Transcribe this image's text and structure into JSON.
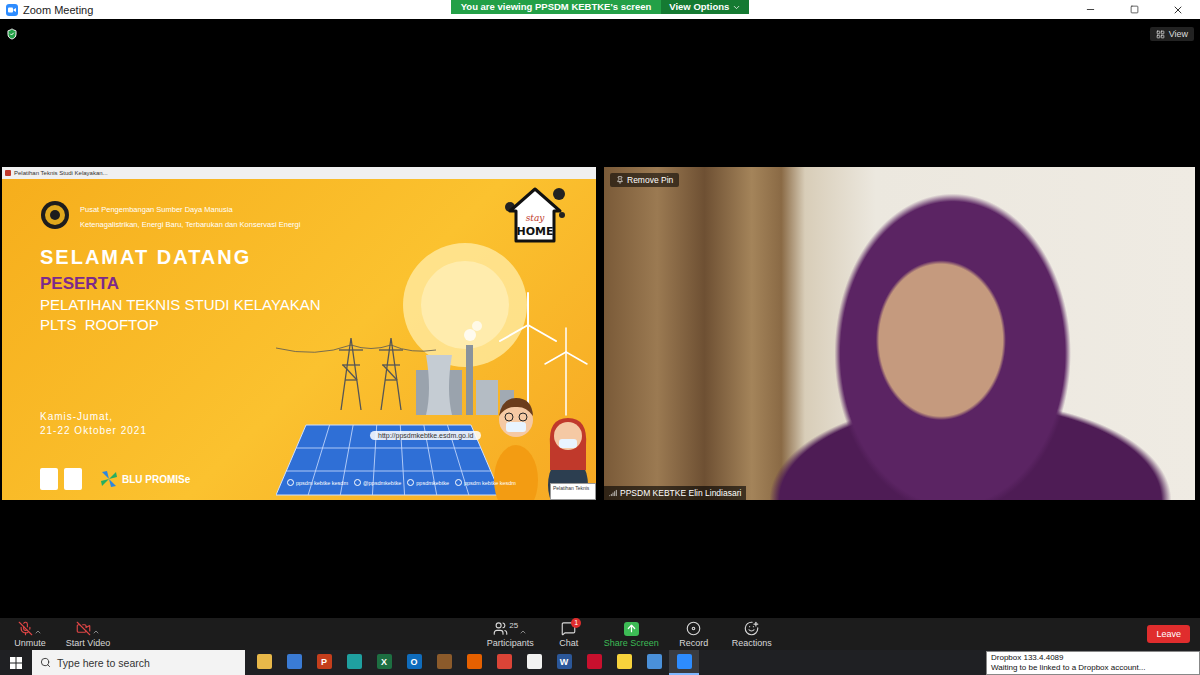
{
  "window": {
    "title": "Zoom Meeting"
  },
  "banner": {
    "text": "You are viewing PPSDM KEBTKE's screen",
    "button": "View Options"
  },
  "view_button": {
    "label": "View"
  },
  "shared_screen": {
    "window_title": "Pelatihan Teknis Studi Kelayakan...",
    "mini_window": "Pelatihan Teknis",
    "slide": {
      "org_lines": [
        "Pusat Pengembangan Sumber Daya Manusia",
        "Ketenagalistrikan, Energi Baru, Terbarukan dan Konservasi Energi"
      ],
      "badge": {
        "top": "stay",
        "bottom": "HOME"
      },
      "greeting": "SELAMAT DATANG",
      "audience": "PESERTA",
      "title_lines": [
        "PELATIHAN TEKNIS STUDI KELAYAKAN",
        "PLTS  ROOFTOP"
      ],
      "date_lines": [
        "Kamis-Jumat,",
        "21-22 Oktober 2021"
      ],
      "url": "http://ppsdmkebtke.esdm.go.id",
      "socials": [
        "ppsdm kebtke kesdm",
        "@ppsdmkebtke",
        "ppsdmkebtke",
        "ppsdm kebtke kesdm"
      ],
      "partner": "BLU PROMISe"
    }
  },
  "video": {
    "pin_button": "Remove Pin",
    "participant_name": "PPSDM KEBTKE Elin Lindiasari"
  },
  "toolbar": {
    "left": [
      {
        "label": "Unmute",
        "kind": "mic",
        "off": true,
        "caret": true
      },
      {
        "label": "Start Video",
        "kind": "video",
        "off": true,
        "caret": true
      }
    ],
    "center": [
      {
        "label": "Participants",
        "kind": "participants",
        "count": "25",
        "caret": true
      },
      {
        "label": "Chat",
        "kind": "chat",
        "badge": "1",
        "caret": false
      },
      {
        "label": "Share Screen",
        "kind": "share",
        "caret": false
      },
      {
        "label": "Record",
        "kind": "record",
        "caret": false
      },
      {
        "label": "Reactions",
        "kind": "reactions",
        "caret": false
      }
    ],
    "leave": "Leave"
  },
  "taskbar": {
    "search_placeholder": "Type here to search",
    "apps": [
      {
        "glyph": "",
        "color": "#e8b84a",
        "selected": false
      },
      {
        "glyph": "",
        "color": "#3a7bd5",
        "selected": false
      },
      {
        "glyph": "P",
        "color": "#c43e1c",
        "selected": false
      },
      {
        "glyph": "",
        "color": "#1fa0a0",
        "selected": false
      },
      {
        "glyph": "X",
        "color": "#1d6f42",
        "selected": false
      },
      {
        "glyph": "O",
        "color": "#0f6cbd",
        "selected": false
      },
      {
        "glyph": "",
        "color": "#8b5a2b",
        "selected": false
      },
      {
        "glyph": "",
        "color": "#e66000",
        "selected": false
      },
      {
        "glyph": "",
        "color": "#db4437",
        "selected": false
      },
      {
        "glyph": "",
        "color": "#f2f2f2",
        "selected": false
      },
      {
        "glyph": "W",
        "color": "#2b579a",
        "selected": false
      },
      {
        "glyph": "",
        "color": "#c8102e",
        "selected": false
      },
      {
        "glyph": "",
        "color": "#f7d33c",
        "selected": false
      },
      {
        "glyph": "",
        "color": "#4a90d9",
        "selected": false
      },
      {
        "glyph": "",
        "color": "#2d8cff",
        "selected": true
      }
    ]
  },
  "notification": {
    "title": "Dropbox 133.4.4089",
    "text": "Waiting to be linked to a Dropbox account..."
  }
}
